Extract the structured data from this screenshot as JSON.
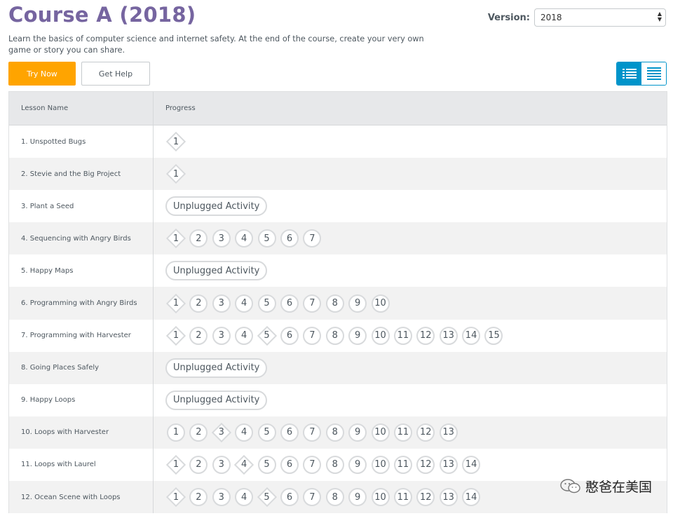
{
  "header": {
    "title": "Course A (2018)",
    "version_label": "Version:",
    "version_value": "2018",
    "description": "Learn the basics of computer science and internet safety. At the end of the course, create your very own game or story you can share."
  },
  "buttons": {
    "try_now": "Try Now",
    "get_help": "Get Help"
  },
  "view_toggle": {
    "active": "list-icon",
    "inactive": "menu-lines-icon",
    "accent_color": "#0094ca"
  },
  "colors": {
    "title": "#7665a0",
    "try_now": "#ffa400"
  },
  "table": {
    "headers": [
      "Lesson Name",
      "Progress"
    ],
    "unplugged_label": "Unplugged Activity",
    "rows": [
      {
        "name": "1. Unspotted Bugs",
        "bubbles": [
          "d"
        ]
      },
      {
        "name": "2. Stevie and the Big Project",
        "bubbles": [
          "d"
        ]
      },
      {
        "name": "3. Plant a Seed",
        "unplugged": true
      },
      {
        "name": "4. Sequencing with Angry Birds",
        "bubbles": [
          "d",
          "c",
          "c",
          "c",
          "c",
          "c",
          "c"
        ]
      },
      {
        "name": "5. Happy Maps",
        "unplugged": true
      },
      {
        "name": "6. Programming with Angry Birds",
        "bubbles": [
          "d",
          "c",
          "c",
          "c",
          "c",
          "c",
          "c",
          "c",
          "c",
          "c"
        ]
      },
      {
        "name": "7. Programming with Harvester",
        "bubbles": [
          "d",
          "c",
          "c",
          "c",
          "d",
          "c",
          "c",
          "c",
          "c",
          "c",
          "c",
          "c",
          "c",
          "c",
          "c"
        ]
      },
      {
        "name": "8. Going Places Safely",
        "unplugged": true
      },
      {
        "name": "9. Happy Loops",
        "unplugged": true
      },
      {
        "name": "10. Loops with Harvester",
        "bubbles": [
          "c",
          "c",
          "d",
          "c",
          "c",
          "c",
          "c",
          "c",
          "c",
          "c",
          "c",
          "c",
          "c"
        ]
      },
      {
        "name": "11. Loops with Laurel",
        "bubbles": [
          "d",
          "c",
          "c",
          "d",
          "c",
          "c",
          "c",
          "c",
          "c",
          "c",
          "c",
          "c",
          "c",
          "c"
        ]
      },
      {
        "name": "12. Ocean Scene with Loops",
        "bubbles": [
          "d",
          "c",
          "c",
          "c",
          "d",
          "c",
          "c",
          "c",
          "c",
          "c",
          "c",
          "c",
          "c",
          "c"
        ]
      }
    ]
  },
  "watermark": {
    "text": "憨爸在美国",
    "icon": "wechat-icon"
  }
}
